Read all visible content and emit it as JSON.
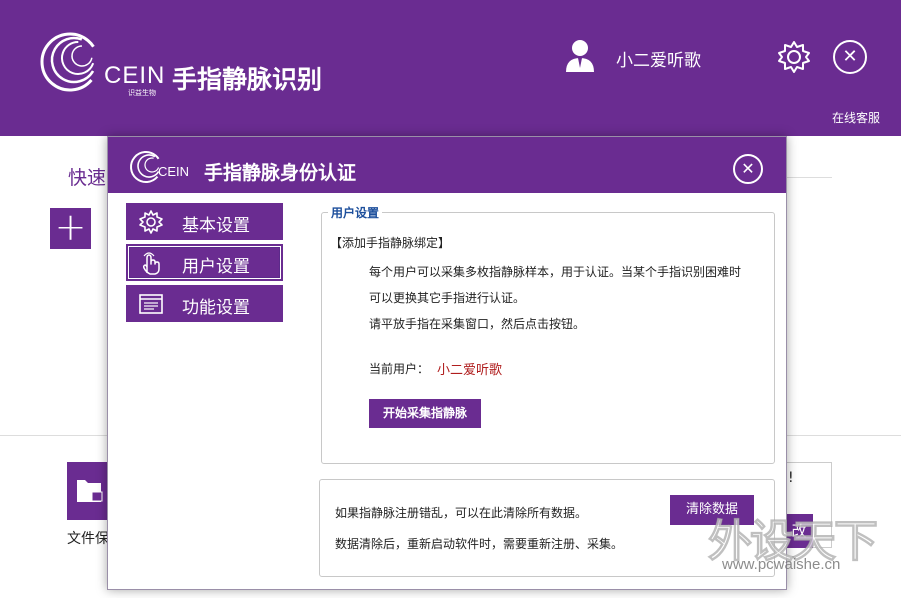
{
  "main": {
    "brand": "CEIN",
    "brand_sub": "识益生物",
    "app_title": "手指静脉识别",
    "username": "小二爱听歌",
    "online_service": "在线客服",
    "quick_label": "快速",
    "file_label": "文件保",
    "card_mark": "!",
    "card_btn": "改"
  },
  "dialog": {
    "brand": "CEIN",
    "title": "手指静脉身份认证",
    "nav": [
      {
        "label": "基本设置",
        "icon": "gear-icon"
      },
      {
        "label": "用户设置",
        "icon": "finger-touch-icon"
      },
      {
        "label": "功能设置",
        "icon": "panel-window-icon"
      }
    ],
    "user_settings": {
      "legend": "用户设置",
      "section_title": "【添加手指静脉绑定】",
      "line1": "每个用户可以采集多枚指静脉样本，用于认证。当某个手指识别困难时",
      "line2": "可以更换其它手指进行认证。",
      "line3": "请平放手指在采集窗口，然后点击按钮。",
      "current_user_label": "当前用户：",
      "current_user_value": "小二爱听歌",
      "start_button": "开始采集指静脉"
    },
    "clear_section": {
      "line1": "如果指静脉注册错乱，可以在此清除所有数据。",
      "line2": "数据清除后，重新启动软件时，需要重新注册、采集。",
      "clear_button": "清除数据"
    }
  },
  "watermark": {
    "text": "外设天下",
    "url": "www.pcwaishe.cn"
  },
  "colors": {
    "brand_purple": "#6a2c91",
    "legend_blue": "#1d4f9c",
    "user_red": "#b01e1e"
  }
}
